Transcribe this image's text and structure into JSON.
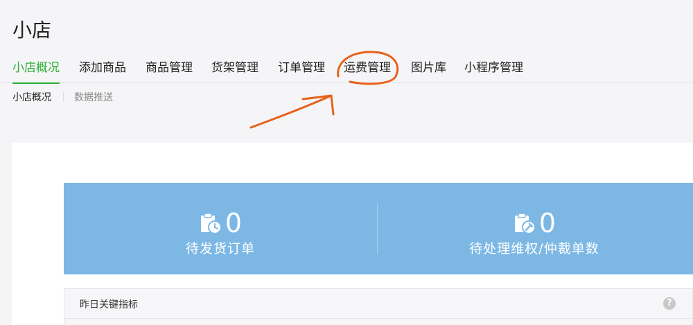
{
  "page": {
    "title": "小店"
  },
  "tabs": [
    {
      "label": "小店概况",
      "active": true
    },
    {
      "label": "添加商品",
      "active": false
    },
    {
      "label": "商品管理",
      "active": false
    },
    {
      "label": "货架管理",
      "active": false
    },
    {
      "label": "订单管理",
      "active": false
    },
    {
      "label": "运费管理",
      "active": false
    },
    {
      "label": "图片库",
      "active": false
    },
    {
      "label": "小程序管理",
      "active": false
    }
  ],
  "subtabs": [
    {
      "label": "小店概况",
      "active": true
    },
    {
      "label": "数据推送",
      "active": false
    }
  ],
  "stats": [
    {
      "value": "0",
      "label": "待发货订单",
      "icon": "clipboard-clock-icon"
    },
    {
      "value": "0",
      "label": "待处理维权/仲裁单数",
      "icon": "clipboard-wrench-icon"
    }
  ],
  "metrics": {
    "title": "昨日关键指标",
    "help": "?"
  },
  "colors": {
    "accent": "#2aae32",
    "banner": "#7db8e5",
    "annotation": "#e8611a"
  }
}
